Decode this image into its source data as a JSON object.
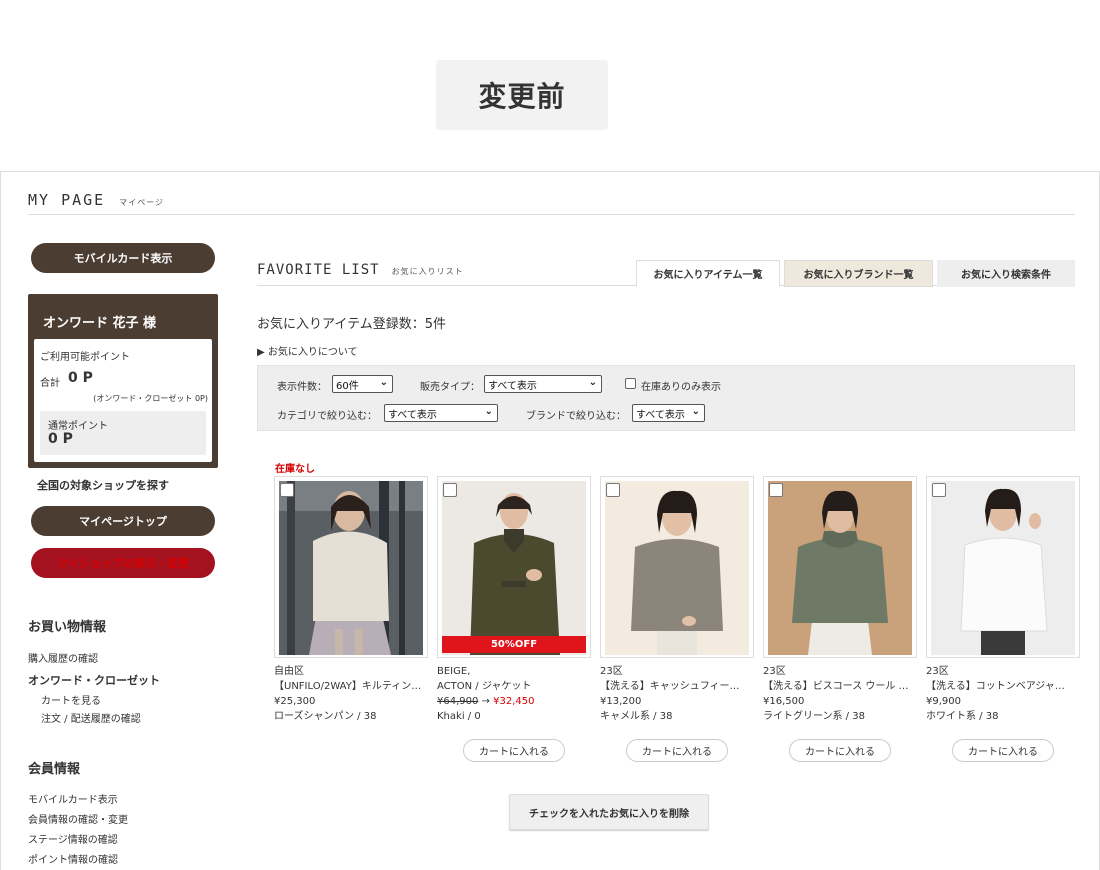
{
  "badge": "変更前",
  "mypage": {
    "en": "MY PAGE",
    "ja": "マイページ"
  },
  "sidebar": {
    "mobile_card": "モバイルカード表示",
    "member_name": "オンワード 花子 様",
    "points_label": "ご利用可能ポイント",
    "total_label": "合計",
    "total_value": "0 P",
    "total_sub": "(オンワード・クローゼット 0P)",
    "normal_label": "通常ポイント",
    "normal_value": "0 P",
    "find_shop": "全国の対象ショップを探す",
    "mypage_top": "マイページトップ",
    "myshop": "マイショップの表示・変更",
    "shopping_heading": "お買い物情報",
    "purchase_history": "購入履歴の確認",
    "closet": "オンワード・クローゼット",
    "view_cart": "カートを見る",
    "order_history": "注文 / 配送履歴の確認",
    "member_heading": "会員情報",
    "mobile_card_link": "モバイルカード表示",
    "member_info": "会員情報の確認・変更",
    "stage_info": "ステージ情報の確認",
    "point_info": "ポイント情報の確認"
  },
  "main": {
    "title_en": "FAVORITE LIST",
    "title_ja": "お気に入りリスト",
    "tabs": [
      "お気に入りアイテム一覧",
      "お気に入りブランド一覧",
      "お気に入り検索条件"
    ],
    "count": "お気に入りアイテム登録数：5件",
    "about": "▶ お気に入りについて",
    "filters": {
      "per_page_label": "表示件数：",
      "per_page_value": "60件",
      "sale_type_label": "販売タイプ：",
      "sale_type_value": "すべて表示",
      "in_stock_label": "在庫ありのみ表示",
      "category_label": "カテゴリで絞り込む：",
      "category_value": "すべて表示",
      "brand_label": "ブランドで絞り込む：",
      "brand_value": "すべて表示"
    },
    "out_of_stock": "在庫なし",
    "products": [
      {
        "brand": "自由区",
        "name": "【UNFILO/2WAY】キルティング…",
        "price": "¥25,300",
        "color": "ローズシャンパン / 38"
      },
      {
        "brand": "BEIGE,",
        "name": "ACTON / ジャケット",
        "price_old": "¥64,900",
        "arrow": "→",
        "price": "¥32,450",
        "color": "Khaki / 0",
        "sale": "50%OFF"
      },
      {
        "brand": "23区",
        "name": "【洗える】キャッシュフィー…",
        "price": "¥13,200",
        "color": "キャメル系 / 38"
      },
      {
        "brand": "23区",
        "name": "【洗える】ビスコース ウール …",
        "price": "¥16,500",
        "color": "ライトグリーン系 / 38"
      },
      {
        "brand": "23区",
        "name": "【洗える】コットンベアジャ…",
        "price": "¥9,900",
        "color": "ホワイト系 / 38"
      }
    ],
    "cart_button": "カートに入れる",
    "delete_button": "チェックを入れたお気に入りを削除"
  }
}
